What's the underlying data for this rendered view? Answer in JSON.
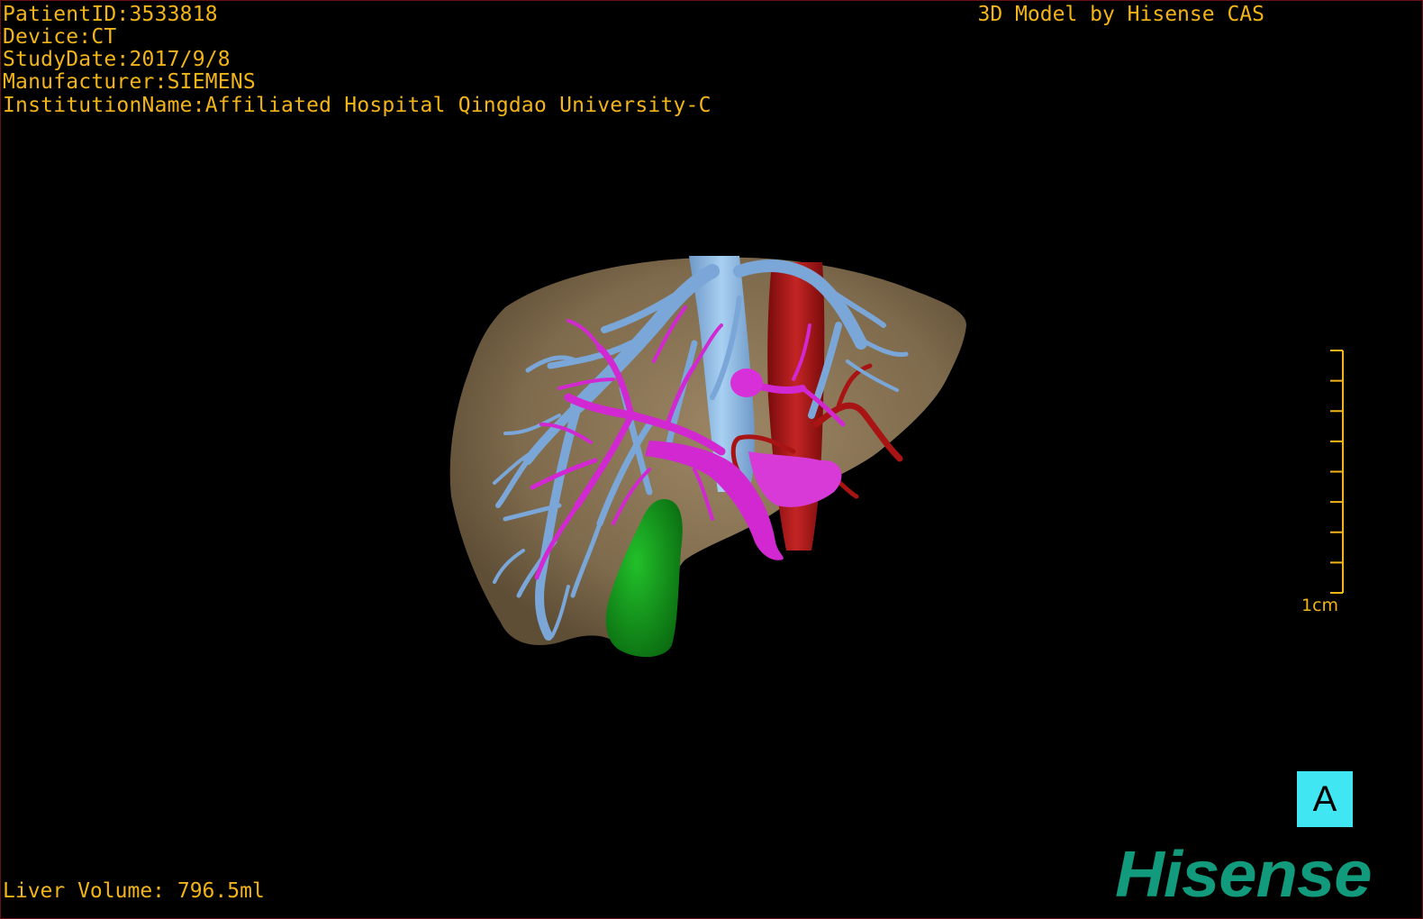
{
  "patient_info": {
    "patient_id": "PatientID:3533818",
    "device": "Device:CT",
    "study_date": "StudyDate:2017/9/8",
    "manufacturer": "Manufacturer:SIEMENS",
    "institution": "InstitutionName:Affiliated Hospital Qingdao University-C"
  },
  "header": {
    "model_credit": "3D Model by Hisense CAS"
  },
  "footer": {
    "liver_volume": "Liver Volume: 796.5ml"
  },
  "scale_bar": {
    "label": "1cm",
    "ticks": 8
  },
  "view": {
    "badge": "A"
  },
  "brand": {
    "logo_text": "Hisense"
  },
  "colors": {
    "overlay_text": "#f2b418",
    "liver": "#8a7656",
    "hepatic_vein": "#7aa6d8",
    "portal_vein": "#d228d2",
    "artery": "#b01818",
    "gallbladder": "#119a1c",
    "badge": "#40e6f2",
    "brand": "#119a7c",
    "frame": "#6a0f14"
  }
}
